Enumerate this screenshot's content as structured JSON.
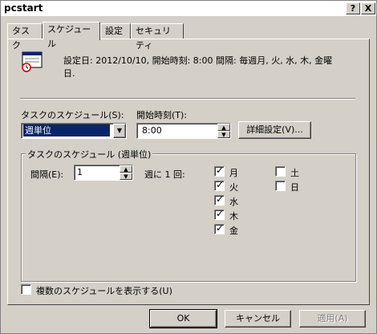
{
  "window": {
    "title": "pcstart",
    "help_button": "?",
    "close_button": "X"
  },
  "tabs": [
    {
      "label": "タスク"
    },
    {
      "label": "スケジュール"
    },
    {
      "label": "設定"
    },
    {
      "label": "セキュリティ"
    }
  ],
  "summary": {
    "line1": "設定日: 2012/10/10, 開始時刻: 8:00  間隔: 毎週月, 火, 水, 木, 金曜",
    "line2": "日."
  },
  "schedule": {
    "label": "タスクのスケジュール(S):",
    "value": "週単位"
  },
  "start_time": {
    "label": "開始時刻(T):",
    "value": "8:00"
  },
  "advanced_button": "詳細設定(V)...",
  "weekly_group": {
    "title": "タスクのスケジュール (週単位)",
    "interval_label": "間隔(E):",
    "interval_value": "1",
    "interval_unit": "週に 1 回:",
    "days": [
      {
        "label": "月",
        "checked": true
      },
      {
        "label": "火",
        "checked": true
      },
      {
        "label": "水",
        "checked": true
      },
      {
        "label": "木",
        "checked": true
      },
      {
        "label": "金",
        "checked": true
      },
      {
        "label": "土",
        "checked": false
      },
      {
        "label": "日",
        "checked": false
      }
    ]
  },
  "multiple_schedules": {
    "label": "複数のスケジュールを表示する(U)",
    "checked": false
  },
  "footer": {
    "ok": "OK",
    "cancel": "キャンセル",
    "apply": "適用(A)"
  }
}
